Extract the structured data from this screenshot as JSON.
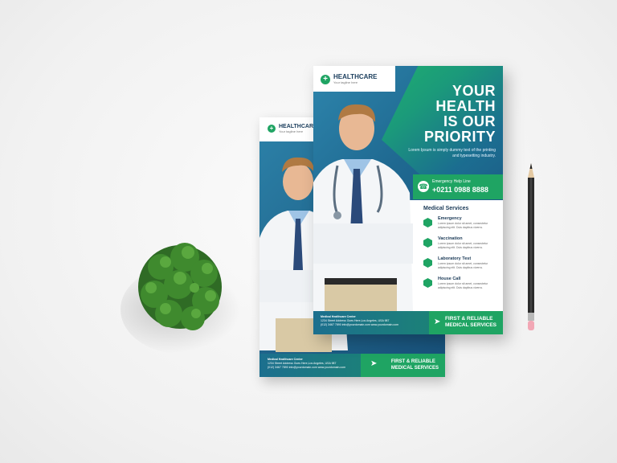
{
  "back_flyer": {
    "brand_name": "HEALTHCARE",
    "brand_tagline": "Your tagline here",
    "footer_company": "Medical Healthcare Center",
    "footer_address": "1234 Street Address Goes Here,Los Angeles, USA 987",
    "footer_phone": "(012) 3467 7890",
    "footer_email": "info@yourdomain.com",
    "footer_web": "www.yourdomain.com",
    "cta_line1": "FIRST & RELIABLE",
    "cta_line2": "MEDICAL SERVICES"
  },
  "front_flyer": {
    "brand_name": "HEALTHCARE",
    "brand_tagline": "Your tagline here",
    "headline_1": "YOUR",
    "headline_2": "HEALTH",
    "headline_3": "IS OUR",
    "headline_4": "PRIORITY",
    "subtext": "Lorem Ipsum is simply dummy text of the printing and typesetting industry.",
    "help_label": "Emergency Help Line",
    "help_number": "+0211 0988 8888",
    "services_title": "Medical Services",
    "services": [
      {
        "name": "Emergency",
        "desc": "Lorem ipsum dolor sit amet, consectetur adipiscing elit. Duis dapibus viverra."
      },
      {
        "name": "Vaccination",
        "desc": "Lorem ipsum dolor sit amet, consectetur adipiscing elit. Duis dapibus viverra."
      },
      {
        "name": "Laboratory Test",
        "desc": "Lorem ipsum dolor sit amet, consectetur adipiscing elit. Duis dapibus viverra."
      },
      {
        "name": "House Call",
        "desc": "Lorem ipsum dolor sit amet, consectetur adipiscing elit. Duis dapibus viverra."
      }
    ],
    "footer_company": "Medical Healthcare Center",
    "footer_address": "1234 Street Address Goes Here,Los Angeles, USA 987",
    "footer_phone": "(012) 3467 7890",
    "footer_email": "info@yourdomain.com",
    "footer_web": "www.yourdomain.com",
    "cta_line1": "FIRST & RELIABLE",
    "cta_line2": "MEDICAL SERVICES"
  },
  "colors": {
    "brand_green": "#1fa463",
    "brand_blue": "#1f6991",
    "navy_text": "#1b3a57"
  },
  "icons": [
    "plus-cross-icon",
    "phone-icon",
    "hexagon-icon",
    "runner-icon"
  ]
}
